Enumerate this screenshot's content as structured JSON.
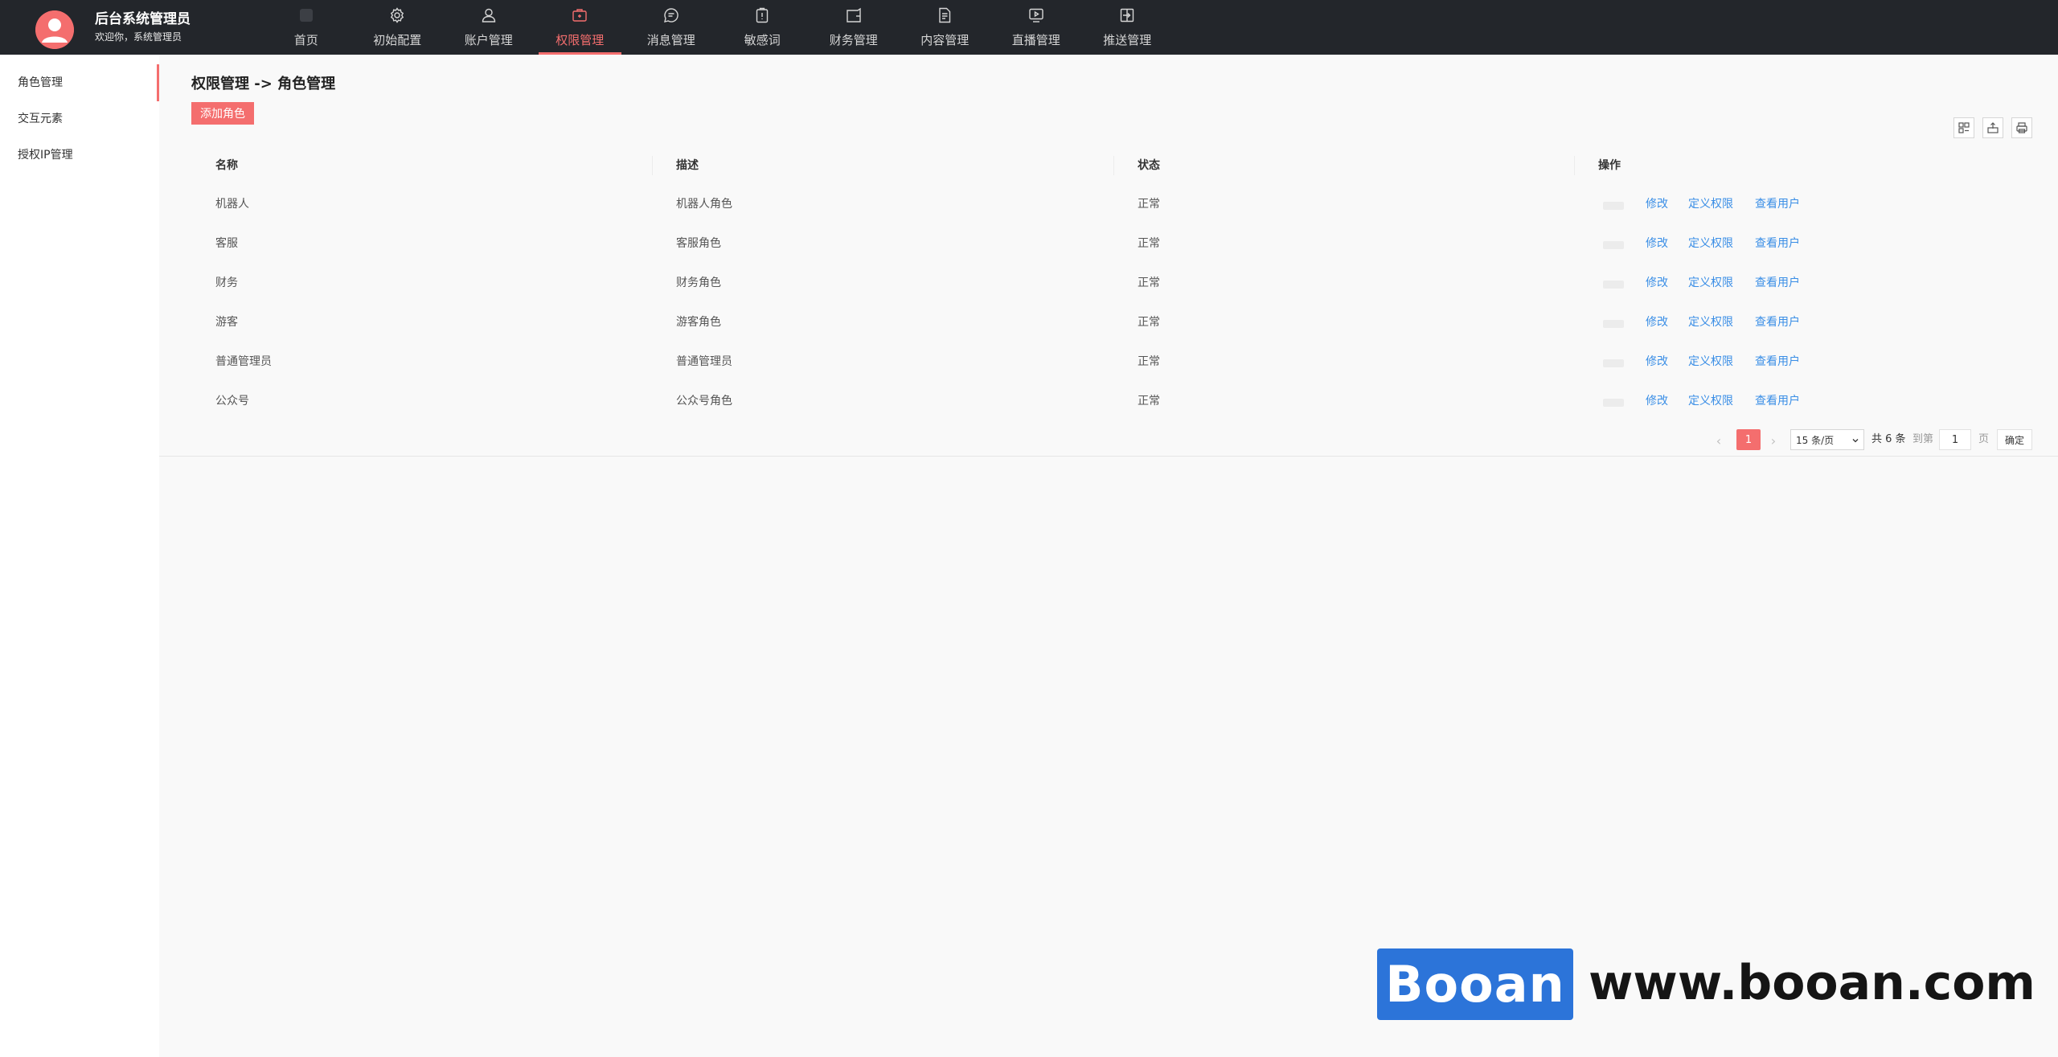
{
  "header": {
    "title": "后台系统管理员",
    "welcome": "欢迎你，系统管理员",
    "nav": [
      {
        "label": "首页",
        "icon": "home-icon"
      },
      {
        "label": "初始配置",
        "icon": "gear-icon"
      },
      {
        "label": "账户管理",
        "icon": "user-icon"
      },
      {
        "label": "权限管理",
        "icon": "briefcase-icon",
        "active": true
      },
      {
        "label": "消息管理",
        "icon": "message-icon"
      },
      {
        "label": "敏感词",
        "icon": "clipboard-icon"
      },
      {
        "label": "财务管理",
        "icon": "wallet-icon"
      },
      {
        "label": "内容管理",
        "icon": "document-icon"
      },
      {
        "label": "直播管理",
        "icon": "live-tv-icon"
      },
      {
        "label": "推送管理",
        "icon": "push-icon"
      }
    ],
    "accent_color": "#f46e6e"
  },
  "sidebar": {
    "items": [
      {
        "label": "角色管理",
        "active": true
      },
      {
        "label": "交互元素"
      },
      {
        "label": "授权IP管理"
      }
    ]
  },
  "main": {
    "breadcrumb": "权限管理 -> 角色管理",
    "add_button": "添加角色",
    "tools": [
      "columns-icon",
      "export-icon",
      "print-icon"
    ],
    "table": {
      "columns": [
        "名称",
        "描述",
        "状态",
        "操作"
      ],
      "rows": [
        {
          "name": "机器人",
          "desc": "机器人角色",
          "status": "正常"
        },
        {
          "name": "客服",
          "desc": "客服角色",
          "status": "正常"
        },
        {
          "name": "财务",
          "desc": "财务角色",
          "status": "正常"
        },
        {
          "name": "游客",
          "desc": "游客角色",
          "status": "正常"
        },
        {
          "name": "普通管理员",
          "desc": "普通管理员",
          "status": "正常"
        },
        {
          "name": "公众号",
          "desc": "公众号角色",
          "status": "正常"
        }
      ],
      "actions": [
        "修改",
        "定义权限",
        "查看用户"
      ]
    },
    "pagination": {
      "current": "1",
      "page_size": "15 条/页",
      "total": "共 6 条",
      "goto_prefix": "到第",
      "goto_value": "1",
      "goto_suffix": "页",
      "confirm": "确定"
    }
  },
  "watermark": {
    "brand": "Booan",
    "url": "www.booan.com"
  }
}
